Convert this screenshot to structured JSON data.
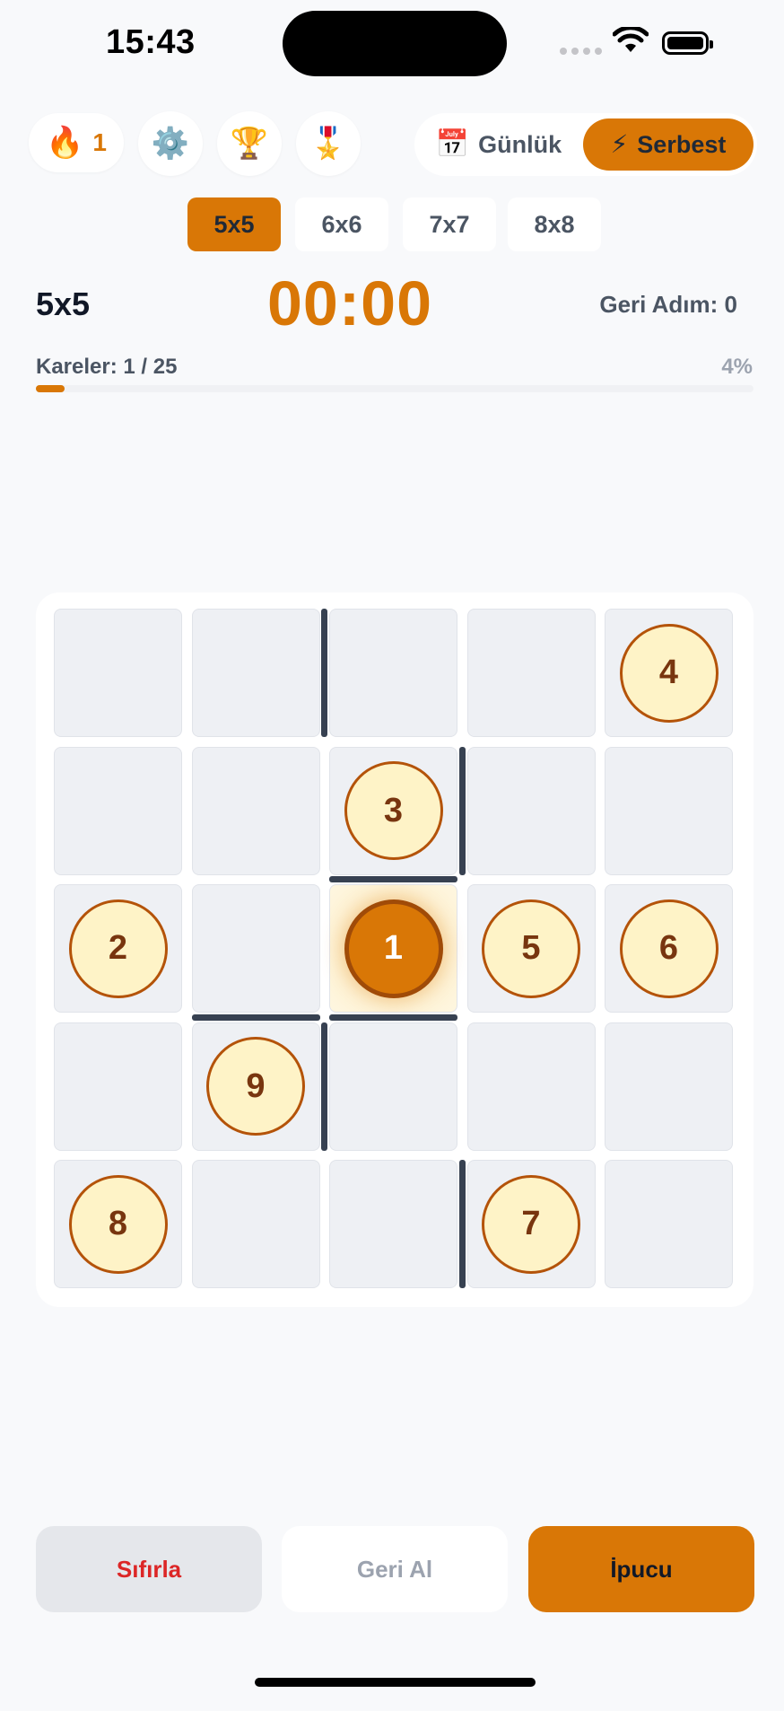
{
  "status": {
    "time": "15:43"
  },
  "header": {
    "streak_count": "1",
    "streak_icon": "🔥",
    "settings_icon": "⚙️",
    "trophy_icon": "🏆",
    "medal_icon": "🎖️",
    "modes": [
      {
        "icon": "📅",
        "label": "Günlük"
      },
      {
        "icon": "⚡",
        "label": "Serbest"
      }
    ]
  },
  "sizes": [
    "5x5",
    "6x6",
    "7x7",
    "8x8"
  ],
  "active_size": "5x5",
  "info": {
    "board_size": "5x5",
    "timer": "00:00",
    "undo_count": "Geri Adım: 0",
    "cells_progress": "Kareler: 1 / 25",
    "percent": "4%",
    "progress_fraction": 0.04
  },
  "board": {
    "rows": 5,
    "cols": 5,
    "numbers": [
      {
        "value": "4",
        "row": 0,
        "col": 4
      },
      {
        "value": "3",
        "row": 1,
        "col": 2
      },
      {
        "value": "2",
        "row": 2,
        "col": 0
      },
      {
        "value": "1",
        "row": 2,
        "col": 2,
        "current": true
      },
      {
        "value": "5",
        "row": 2,
        "col": 3
      },
      {
        "value": "6",
        "row": 2,
        "col": 4
      },
      {
        "value": "9",
        "row": 3,
        "col": 1
      },
      {
        "value": "8",
        "row": 4,
        "col": 0
      },
      {
        "value": "7",
        "row": 4,
        "col": 3
      }
    ],
    "walls": [
      {
        "type": "v",
        "row": 0,
        "between": [
          1,
          2
        ]
      },
      {
        "type": "v",
        "row": 1,
        "between": [
          2,
          3
        ]
      },
      {
        "type": "h",
        "col": 2,
        "between": [
          1,
          2
        ]
      },
      {
        "type": "h",
        "col": 1,
        "between": [
          2,
          3
        ]
      },
      {
        "type": "h",
        "col": 2,
        "between": [
          2,
          3
        ]
      },
      {
        "type": "v",
        "row": 3,
        "between": [
          1,
          2
        ]
      },
      {
        "type": "v",
        "row": 4,
        "between": [
          2,
          3
        ]
      }
    ]
  },
  "actions": {
    "reset": "Sıfırla",
    "undo": "Geri Al",
    "hint": "İpucu"
  }
}
